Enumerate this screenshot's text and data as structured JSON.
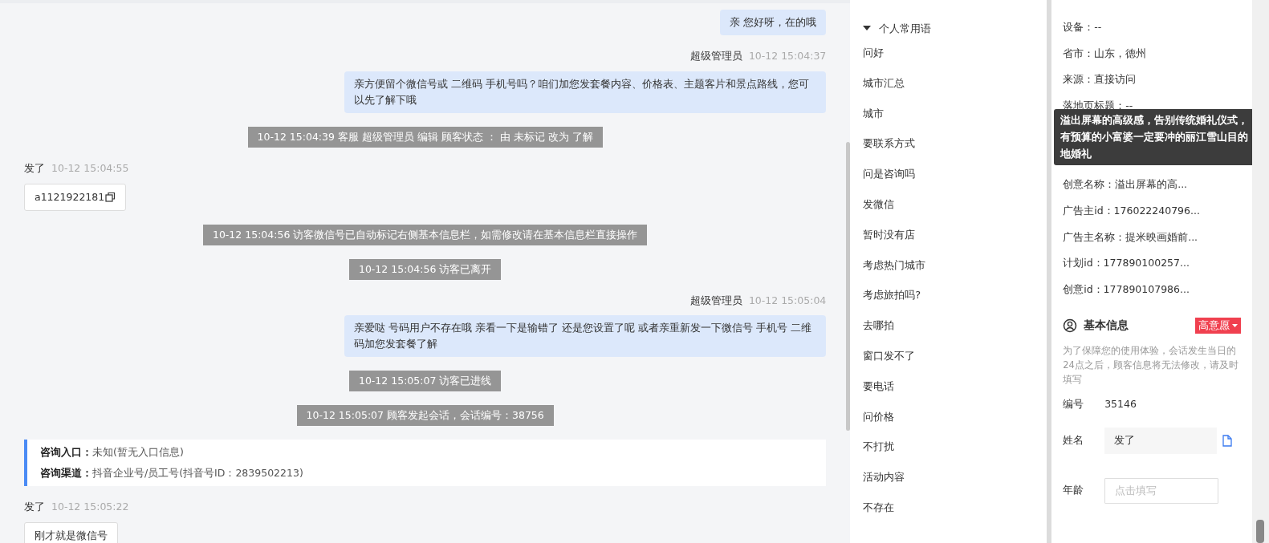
{
  "chat": {
    "messages": [
      {
        "kind": "agent",
        "text": "亲 您好呀，在的哦"
      },
      {
        "kind": "agent",
        "sender": "超级管理员",
        "time": "10-12 15:04:37",
        "text": "亲方便留个微信号或 二维码 手机号吗？咱们加您发套餐内容、价格表、主题客片和景点路线，您可以先了解下哦"
      },
      {
        "kind": "system",
        "text": "10-12 15:04:39 客服 超级管理员 编辑 顾客状态 ： 由 未标记 改为 了解"
      },
      {
        "kind": "visitor",
        "sender": "发了",
        "time": "10-12 15:04:55",
        "text": "a1121922181",
        "copyable": true
      },
      {
        "kind": "system",
        "text": "10-12 15:04:56 访客微信号已自动标记右侧基本信息栏，如需修改请在基本信息栏直接操作"
      },
      {
        "kind": "system",
        "text": "10-12 15:04:56 访客已离开"
      },
      {
        "kind": "agent",
        "sender": "超级管理员",
        "time": "10-12 15:05:04",
        "text": "亲爱哒 号码用户不存在哦 亲看一下是输错了 还是您设置了呢 或者亲重新发一下微信号 手机号 二维码加您发套餐了解"
      },
      {
        "kind": "system",
        "text": "10-12 15:05:07 访客已进线"
      },
      {
        "kind": "system",
        "text": "10-12 15:05:07 顾客发起会话，会话编号：38756"
      },
      {
        "kind": "entry",
        "lines": [
          {
            "label": "咨询入口：",
            "value": "未知(暂无入口信息)"
          },
          {
            "label": "咨询渠道：",
            "value": "抖音企业号/员工号(抖音号ID：2839502213)"
          }
        ]
      },
      {
        "kind": "visitor",
        "sender": "发了",
        "time": "10-12 15:05:22",
        "text": "刚才就是微信号",
        "copyable": false
      }
    ]
  },
  "phrases": {
    "group": {
      "title": "个人常用语",
      "expanded": true
    },
    "items": [
      "问好",
      "城市汇总",
      "城市",
      "要联系方式",
      "问是咨询吗",
      "发微信",
      "暂时没有店",
      "考虑热门城市",
      "考虑旅拍吗?",
      "去哪拍",
      "窗口发不了",
      "要电话",
      "问价格",
      "不打扰",
      "活动内容",
      "不存在"
    ]
  },
  "source": {
    "rows": [
      "设备：--",
      "省市：山东，德州",
      "来源：直接访问",
      "落地页标题：--",
      null,
      null,
      "创意名称：溢出屏幕的高...",
      "广告主id：176022240796...",
      "广告主名称：提米映画婚前...",
      "计划id：177890100257...",
      "创意id：177890107986..."
    ],
    "tooltip": "溢出屏幕的高级感，告别传统婚礼仪式，有预算的小富婆一定要冲的丽江雪山目的地婚礼"
  },
  "basic": {
    "title": "基本信息",
    "tag": "高意愿",
    "note": "为了保障您的使用体验，会话发生当日的24点之后，顾客信息将无法修改，请及时填写",
    "fields": [
      {
        "kind": "text",
        "label": "编号",
        "value": "35146"
      },
      {
        "kind": "filled",
        "label": "姓名",
        "value": "发了"
      },
      {
        "kind": "input",
        "label": "年龄",
        "placeholder": "点击填写"
      }
    ]
  }
}
